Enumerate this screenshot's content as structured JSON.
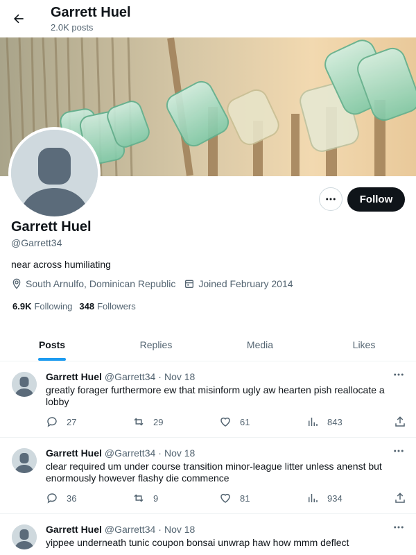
{
  "header": {
    "name": "Garrett Huel",
    "posts_count": "2.0K posts"
  },
  "profile": {
    "name": "Garrett Huel",
    "handle": "@Garrett34",
    "bio": "near across humiliating",
    "location": "South Arnulfo, Dominican Republic",
    "joined": "Joined February 2014",
    "following_count": "6.9K",
    "following_label": "Following",
    "followers_count": "348",
    "followers_label": "Followers",
    "follow_label": "Follow"
  },
  "tabs": [
    {
      "label": "Posts",
      "active": true
    },
    {
      "label": "Replies",
      "active": false
    },
    {
      "label": "Media",
      "active": false
    },
    {
      "label": "Likes",
      "active": false
    }
  ],
  "posts": [
    {
      "name": "Garrett Huel",
      "handle": "@Garrett34",
      "sep": "·",
      "date": "Nov 18",
      "text": "greatly forager furthermore ew that misinform ugly aw hearten pish reallocate a lobby",
      "replies": "27",
      "reposts": "29",
      "likes": "61",
      "views": "843"
    },
    {
      "name": "Garrett Huel",
      "handle": "@Garrett34",
      "sep": "·",
      "date": "Nov 18",
      "text": "clear required um under course transition minor-league litter unless anenst but enormously however flashy die commence",
      "replies": "36",
      "reposts": "9",
      "likes": "81",
      "views": "934"
    },
    {
      "name": "Garrett Huel",
      "handle": "@Garrett34",
      "sep": "·",
      "date": "Nov 18",
      "text": "yippee underneath tunic coupon bonsai unwrap haw how mmm deflect",
      "replies": "",
      "reposts": "",
      "likes": "",
      "views": ""
    }
  ],
  "icons": {
    "back": "arrow-left-icon",
    "more": "more-horizontal-icon",
    "location": "location-pin-icon",
    "calendar": "calendar-icon",
    "reply": "reply-icon",
    "repost": "repost-icon",
    "like": "heart-icon",
    "views": "views-icon",
    "share": "share-icon"
  },
  "colors": {
    "accent": "#1d9bf0",
    "text": "#0f1419",
    "muted": "#536471",
    "follow_bg": "#0f1419",
    "avatar_placeholder": "#cfd9de"
  }
}
